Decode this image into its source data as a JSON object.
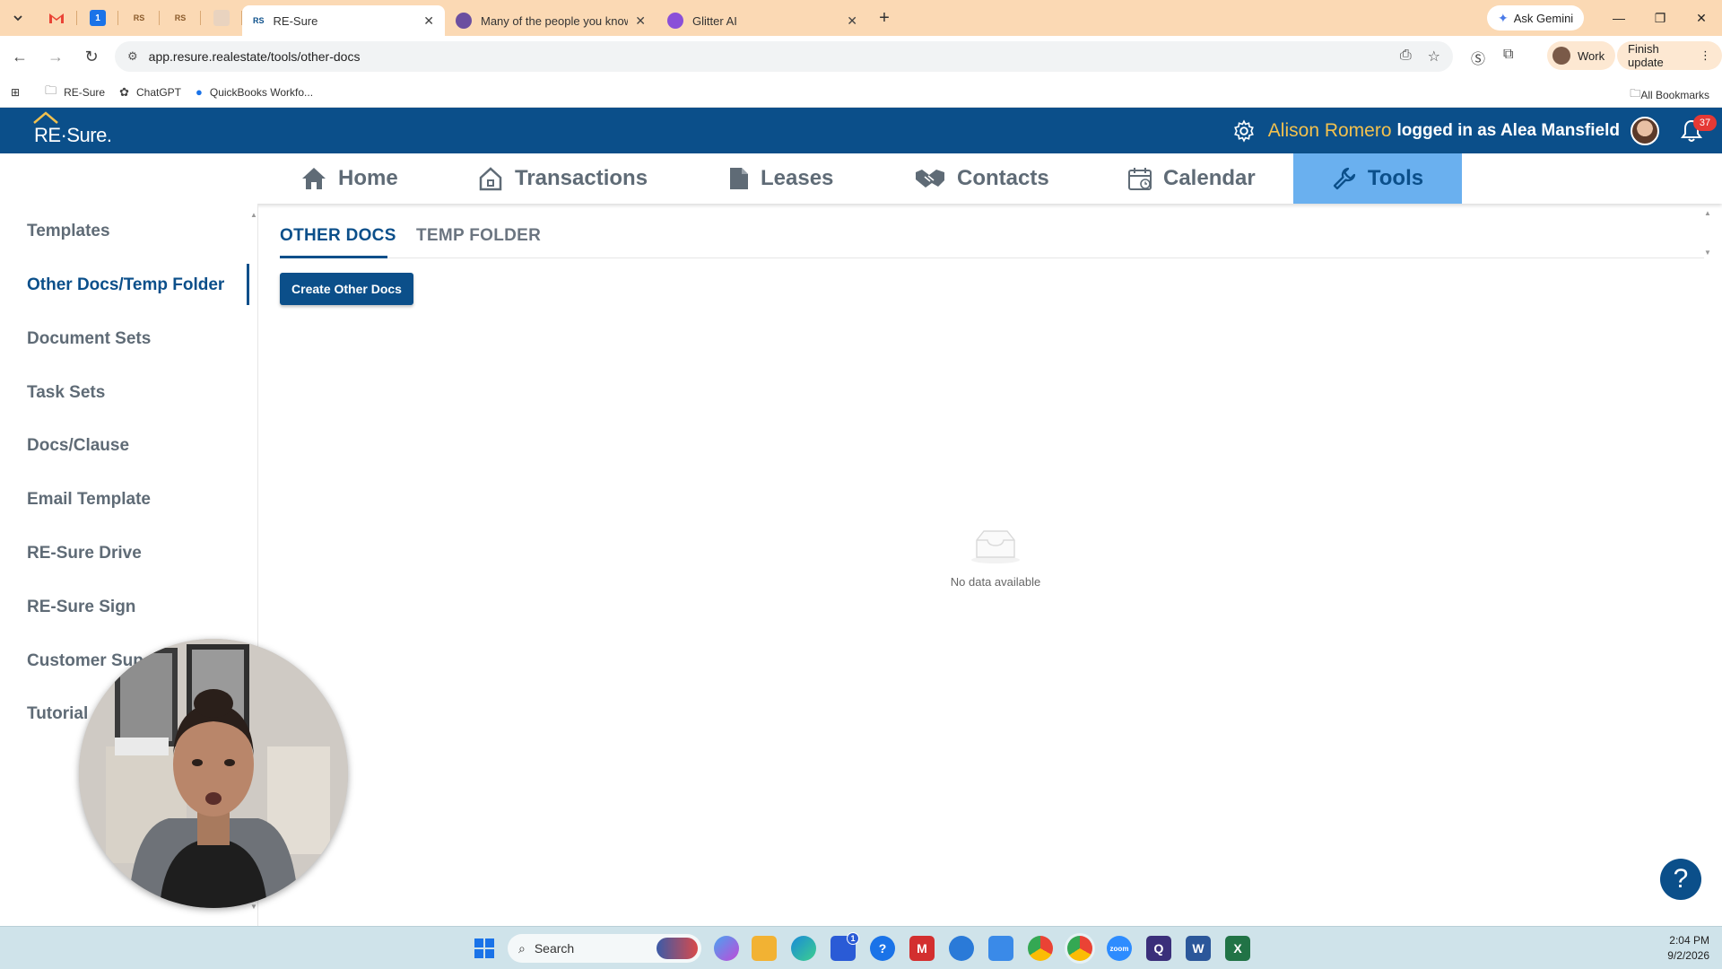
{
  "browser": {
    "tabs": [
      {
        "title": "RE-Sure",
        "active": true
      },
      {
        "title": "Many of the people you know a",
        "active": false
      },
      {
        "title": "Glitter AI",
        "active": false
      }
    ],
    "pinned_labels": {
      "rs1": "RS",
      "rs2": "RS",
      "one": "1"
    },
    "ask_gemini": "Ask Gemini",
    "url": "app.resure.realestate/tools/other-docs",
    "profile": "Work",
    "finish_update": "Finish update",
    "bookmarks": [
      "RE-Sure",
      "ChatGPT",
      "QuickBooks Workfo..."
    ],
    "all_bookmarks": "All Bookmarks"
  },
  "header": {
    "logo": "RE·Sure.",
    "user_name": "Alison Romero",
    "logged_in_as": "logged in as Alea Mansfield",
    "notifications": "37"
  },
  "nav": {
    "items": [
      "Home",
      "Transactions",
      "Leases",
      "Contacts",
      "Calendar",
      "Tools"
    ],
    "active": "Tools"
  },
  "sidebar": {
    "items": [
      "Templates",
      "Other Docs/Temp Folder",
      "Document Sets",
      "Task Sets",
      "Docs/Clause",
      "Email Template",
      "RE-Sure Drive",
      "RE-Sure Sign",
      "Customer Sup",
      "Tutorial"
    ],
    "active_index": 1
  },
  "content": {
    "tabs": [
      "OTHER DOCS",
      "TEMP FOLDER"
    ],
    "active_tab": "OTHER DOCS",
    "create_button": "Create Other Docs",
    "empty_text": "No data available",
    "help": "?"
  },
  "taskbar": {
    "search_placeholder": "Search",
    "time": "2:04 PM",
    "date": "9/2/2026",
    "store_badge": "1"
  },
  "colors": {
    "brand": "#0b4f8a",
    "nav_active_bg": "#6ab0ef",
    "user_name": "#f2c14e",
    "tab_strip": "#fbd9b4",
    "badge": "#e53935"
  }
}
